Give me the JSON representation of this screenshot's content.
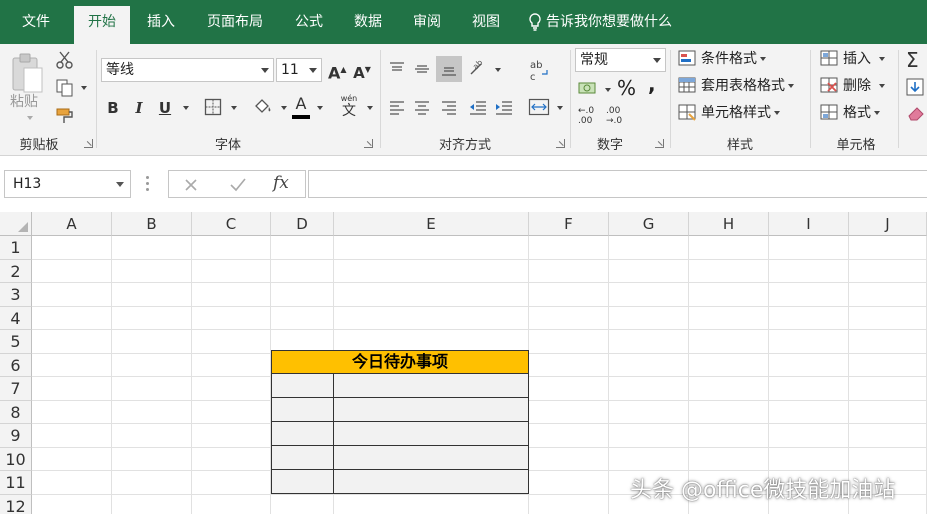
{
  "tabs": [
    "文件",
    "开始",
    "插入",
    "页面布局",
    "公式",
    "数据",
    "审阅",
    "视图"
  ],
  "active_tab": "开始",
  "tell_me": "告诉我你想要做什么",
  "ribbon": {
    "clipboard": {
      "paste": "粘贴",
      "label": "剪贴板"
    },
    "font": {
      "name": "等线",
      "size": "11",
      "label": "字体",
      "bold": "B",
      "italic": "I",
      "underline": "U",
      "font_color": "A",
      "phonetic": "wén"
    },
    "alignment": {
      "label": "对齐方式"
    },
    "number": {
      "format": "常规",
      "label": "数字",
      "percent": "%",
      "comma": ","
    },
    "styles": {
      "conditional": "条件格式",
      "table_format": "套用表格格式",
      "cell_styles": "单元格样式",
      "label": "样式"
    },
    "cells": {
      "insert": "插入",
      "delete": "删除",
      "format": "格式",
      "label": "单元格"
    }
  },
  "formula_bar": {
    "name_box": "H13",
    "fx": "fx",
    "formula": ""
  },
  "columns": [
    "A",
    "B",
    "C",
    "D",
    "E",
    "F",
    "G",
    "H",
    "I",
    "J"
  ],
  "rows": [
    "1",
    "2",
    "3",
    "4",
    "5",
    "6",
    "7",
    "8",
    "9",
    "10",
    "11",
    "12"
  ],
  "todo_title": "今日待办事项",
  "watermark": "头条 @office微技能加油站",
  "colors": {
    "brand": "#217346",
    "header_fill": "#ffc000",
    "cell_fill": "#f2f2f2"
  }
}
